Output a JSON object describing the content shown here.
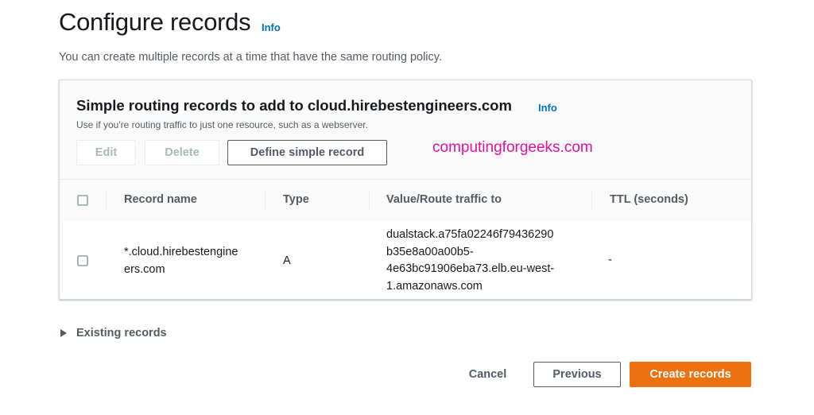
{
  "header": {
    "title": "Configure records",
    "info_label": "Info",
    "description": "You can create multiple records at a time that have the same routing policy."
  },
  "panel": {
    "title": "Simple routing records to add to cloud.hirebestengineers.com",
    "info_label": "Info",
    "description": "Use if you're routing traffic to just one resource, such as a webserver.",
    "buttons": {
      "edit": "Edit",
      "delete": "Delete",
      "define": "Define simple record"
    }
  },
  "watermark": "computingforgeeks.com",
  "table": {
    "columns": [
      "Record name",
      "Type",
      "Value/Route traffic to",
      "TTL (seconds)"
    ],
    "rows": [
      {
        "record_name_lines": [
          "*.cloud.hirebestengine",
          "ers.com"
        ],
        "type": "A",
        "value_lines": [
          "dualstack.a75fa02246f79436290",
          "b35e8a00a00b5-",
          "4e63bc91906eba73.elb.eu-west-",
          "1.amazonaws.com"
        ],
        "ttl": "-"
      }
    ]
  },
  "existing_records": "Existing records",
  "footer": {
    "cancel": "Cancel",
    "previous": "Previous",
    "create": "Create records"
  },
  "colors": {
    "primary": "#ec7211",
    "link": "#0073bb",
    "watermark": "#e20fa1"
  },
  "icons": {
    "expand": "caret-right-icon"
  }
}
